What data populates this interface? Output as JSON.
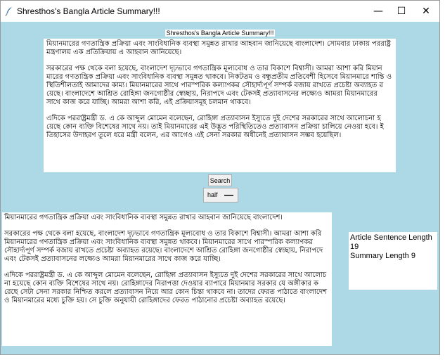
{
  "window": {
    "title": "Shresthos's Bangla Article Summary!!!",
    "icon": "feather-icon",
    "controls": {
      "minimize": "—",
      "maximize": "☐",
      "close": "✕"
    }
  },
  "header": {
    "label": "Shresthos's Bangla Article Summary!!!"
  },
  "article": {
    "paragraphs": [
      "মিয়ানমারের গণতান্ত্রিক প্রক্রিয়া এবং সাংবিধানিক ব্যবস্থা সমুন্নত রাখার আহবান জানিয়েছে বাংলাদেশ। সোমবার ঢাকায় পররাষ্ট্র মন্ত্রণালয় এক প্রতিক্রিয়ায় এ আহবান জানিয়েছে।",
      "সরকারের পক্ষ থেকে বলা হয়েছে, বাংলাদেশ দৃঢ়ভাবে গণতান্ত্রিক মূল্যবোধ ও তার বিকাশে বিশ্বাসী। আমরা আশা করি মিয়ানমারের গণতান্ত্রিক প্রক্রিয়া এবং সাংবিধানিক ব্যবস্থা সমুন্নত থাকবে। নিকটতম ও বন্ধুপ্রতীম প্রতিবেশী হিসেবে মিয়ানমারে শান্তি ও স্থিতিশীলতাই আমাদের কাম্য। মিয়ানমারের সাথে পারস্পরিক কল্যাণকর সৌহার্দ্যপূর্ণ সম্পর্ক বজায় রাখতে প্রচেষ্টা অব্যাহত রয়েছে। বাংলাদেশে আশ্রিত রোহিঙ্গা জনগোষ্ঠীর স্বেচ্ছায়, নিরাপদে এবং টেকসই প্রত্যাবাসনের লক্ষ্যেও আমরা মিয়ানমারের সাথে কাজ করে যাচ্ছি। আমরা আশা করি, এই প্রক্রিয়াসমূহ চলমান থাকবে।",
      "এদিকে পররাষ্ট্রমন্ত্রী ড. এ কে আব্দুল মোমেন বলেছেন, রোহিঙ্গা প্রত্যাবাসন ইস্যুতে দুই দেশের সরকারের সাথে আলোচনা হয়েছে কোন ব্যক্তি বিশেষের সাথে নয়। তাই মিয়ানমারের এই উদ্ভূত পরিস্থিতিতেও প্রত্যাবাসন প্রক্রিয়া চালিয়ে নেওয়া হবে। ইতিহাসের উদাহরণ তুলে ধরে মন্ত্রী বলেন, এর আগেও এই সেনা সরকার অধীনেই প্রত্যাবাসন সম্ভব হয়েছিল।"
    ]
  },
  "controls": {
    "search_label": "Search",
    "mode_value": "half"
  },
  "summary": {
    "paragraphs": [
      "মিয়ানমারের গণতান্ত্রিক প্রক্রিয়া এবং সাংবিধানিক ব্যবস্থা সমুন্নত রাখার আহবান জানিয়েছে বাংলাদেশ।",
      "সরকারের পক্ষ থেকে বলা হয়েছে, বাংলাদেশ দৃঢ়ভাবে গণতান্ত্রিক মূল্যবোধ ও তার বিকাশে বিশ্বাসী। আমরা আশা করি মিয়ানমারের গণতান্ত্রিক প্রক্রিয়া এবং সাংবিধানিক ব্যবস্থা সমুন্নত থাকবে। মিয়ানমারের সাথে পারস্পরিক কল্যাণকর সৌহার্দ্যপূর্ণ সম্পর্ক বজায় রাখতে প্রচেষ্টা অব্যাহত রয়েছে। বাংলাদেশে আশ্রিত রোহিঙ্গা জনগোষ্ঠীর স্বেচ্ছায়, নিরাপদে এবং টেকসই প্রত্যাবাসনের লক্ষ্যেও আমরা মিয়ানমারের সাথে কাজ করে যাচ্ছি।",
      "এদিকে পররাষ্ট্রমন্ত্রী ড. এ কে আব্দুল মোমেন বলেছেন, রোহিঙ্গা প্রত্যাবাসন ইস্যুতে দুই দেশের সরকারের সাথে আলোচনা হয়েছে কোন ব্যক্তি বিশেষের সাথে নয়। রোহিঙ্গাদের নিরাপত্তা দেওয়ার ব্যাপারে মিয়ানমার সরকার যে অঙ্গীকার করেছে সেটা সেনা সরকার নিশ্চিত করলে প্রত্যাবাসন নিয়ে আর কোন চিন্তা থাকবে না। তাদের ফেরত পাঠাতে বাংলাদেশ ও মিয়ানমারের মধ্যে চুক্তি হয়। সে চুক্তি অনুযায়ী রোহিঙ্গাদের ফেরত পাঠানোর প্রচেষ্টা অব্যাহত রয়েছে।"
    ]
  },
  "stats": {
    "article_label": "Article Sentence Length",
    "article_value": "19",
    "summary_line": "Summary Length 9"
  }
}
